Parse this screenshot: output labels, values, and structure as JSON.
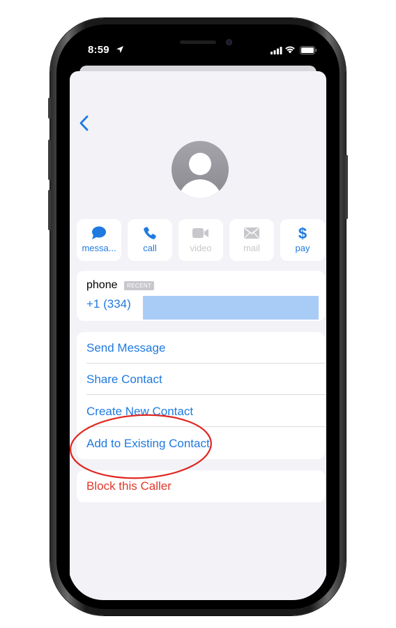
{
  "status_bar": {
    "time": "8:59",
    "location_icon": "location-arrow-icon",
    "signal_icon": "cellular-signal-icon",
    "wifi_icon": "wifi-icon",
    "battery_icon": "battery-icon"
  },
  "header": {
    "back_icon": "chevron-left-icon",
    "avatar_icon": "person-avatar-icon"
  },
  "actions": [
    {
      "label": "messa...",
      "icon": "message-bubble-icon",
      "enabled": true
    },
    {
      "label": "call",
      "icon": "phone-icon",
      "enabled": true
    },
    {
      "label": "video",
      "icon": "video-camera-icon",
      "enabled": false
    },
    {
      "label": "mail",
      "icon": "envelope-icon",
      "enabled": false
    },
    {
      "label": "pay",
      "icon": "dollar-icon",
      "enabled": true
    }
  ],
  "phone_info": {
    "label": "phone",
    "badge": "RECENT",
    "number": "+1 (334) "
  },
  "options": [
    {
      "label": "Send Message"
    },
    {
      "label": "Share Contact"
    },
    {
      "label": "Create New Contact"
    },
    {
      "label": "Add to Existing Contact"
    }
  ],
  "block": {
    "label": "Block this Caller"
  },
  "colors": {
    "accent": "#1f7ae0",
    "destructive": "#e0382b",
    "background": "#f2f2f7",
    "annotation": "#e0261f",
    "redaction": "#a9ccf7"
  }
}
